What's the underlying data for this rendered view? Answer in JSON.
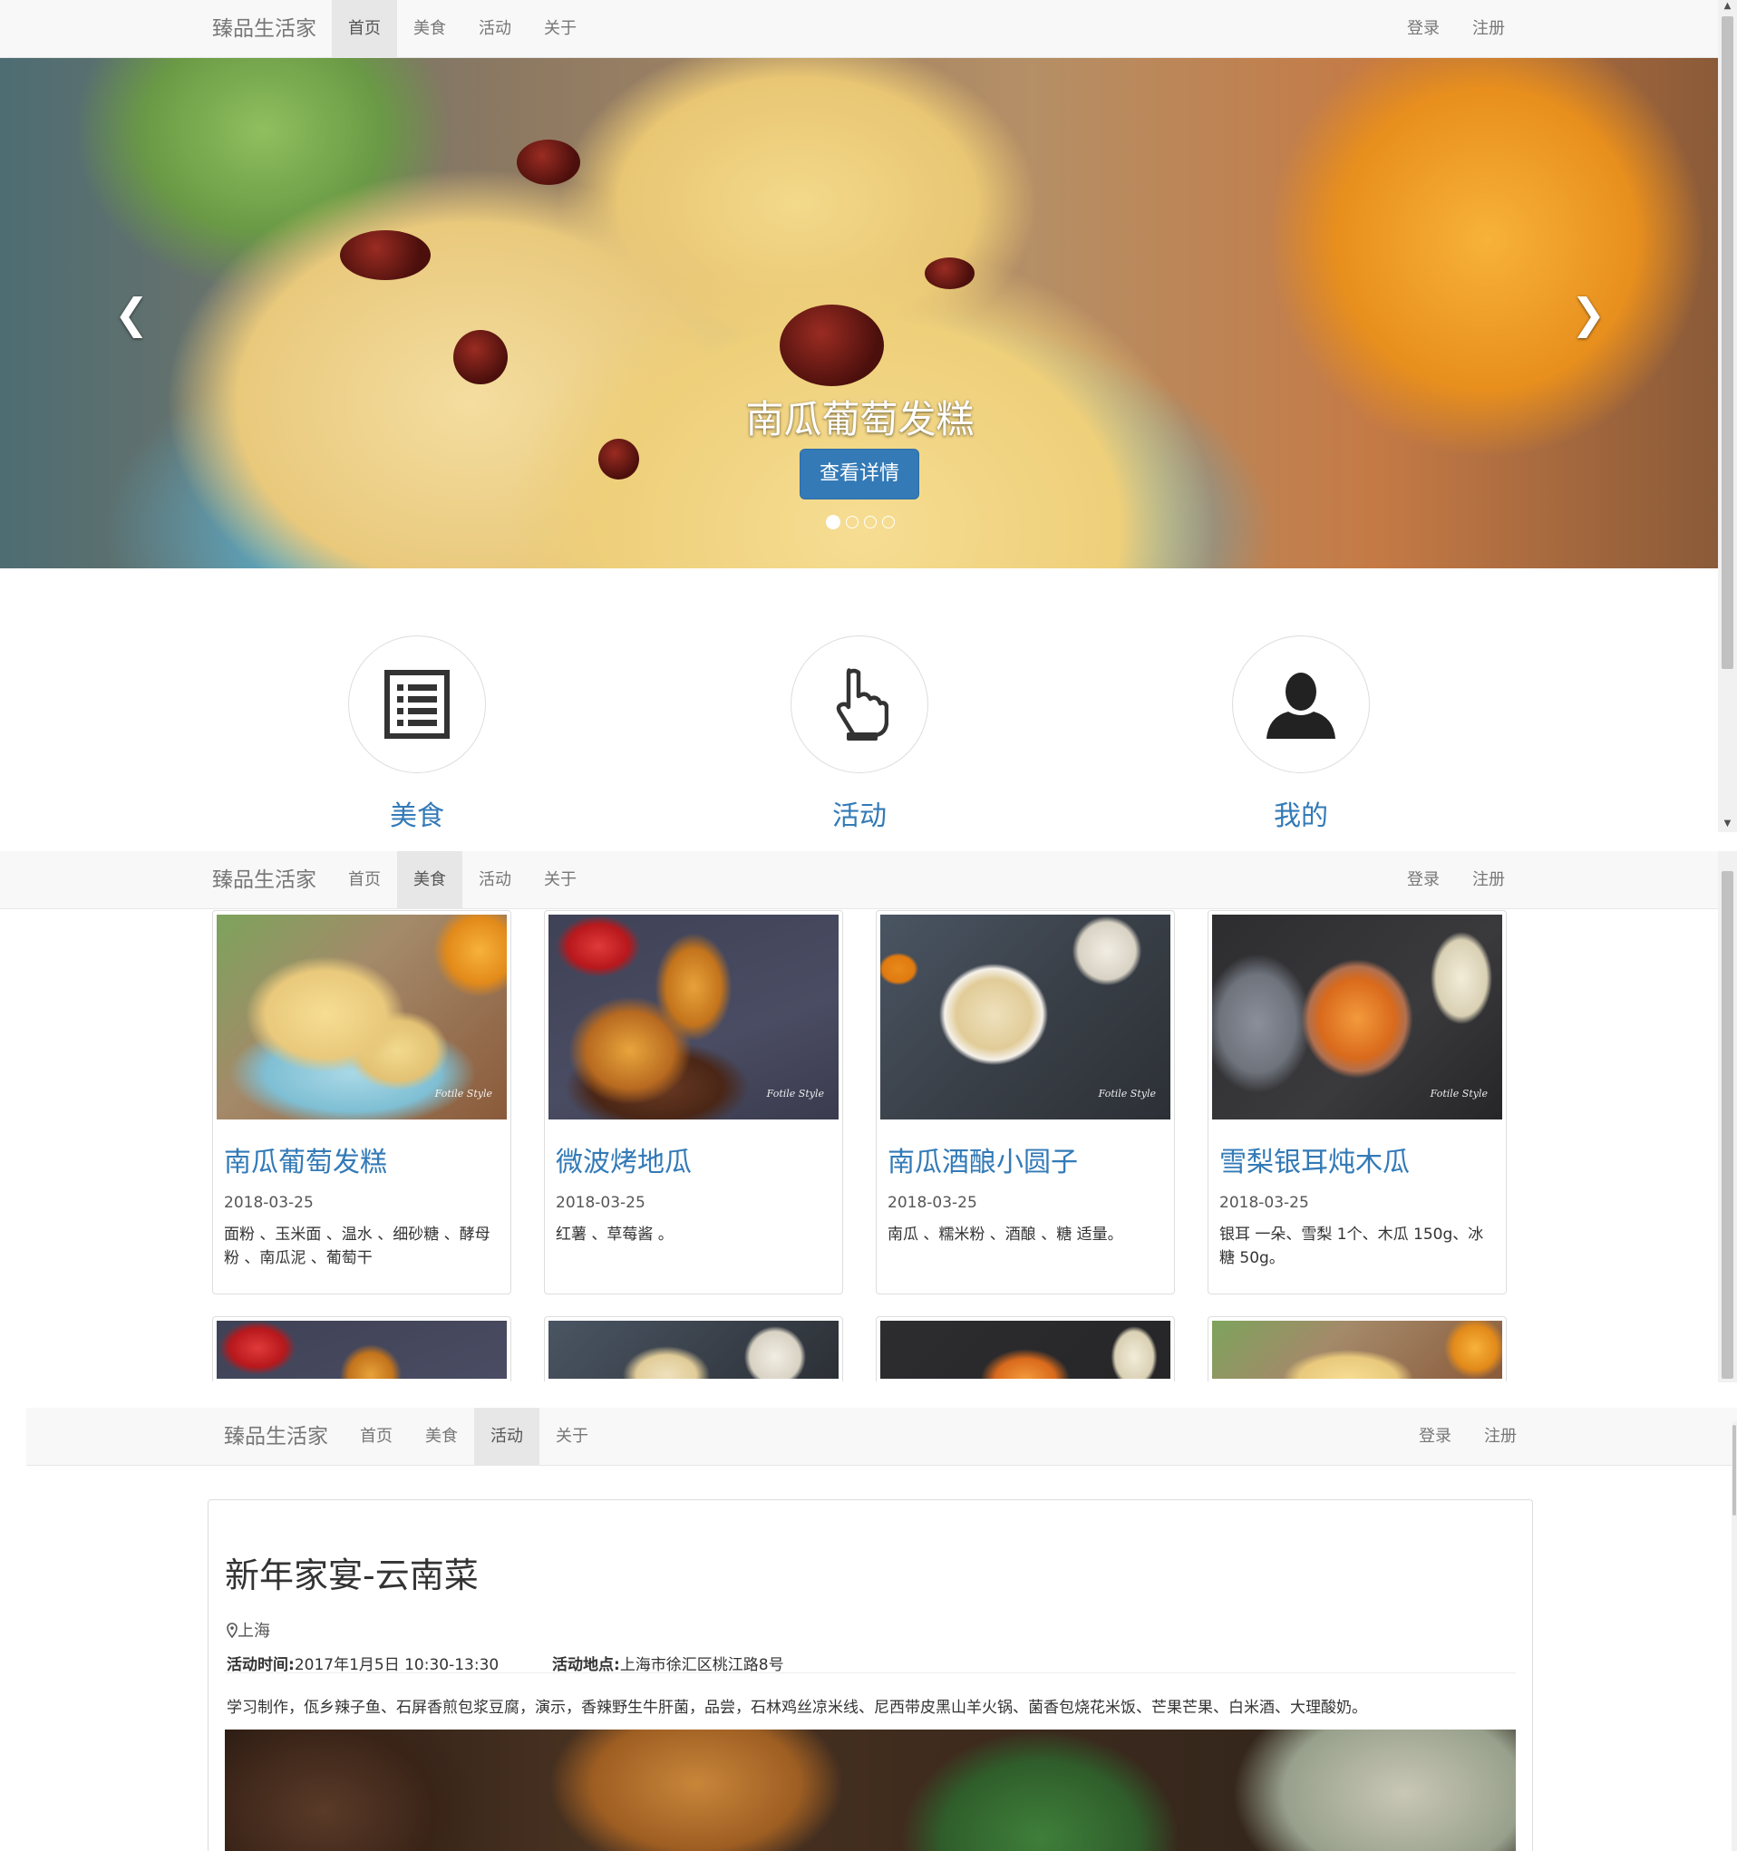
{
  "brand": "臻品生活家",
  "nav": {
    "home": "首页",
    "food": "美食",
    "activity": "活动",
    "about": "关于",
    "login": "登录",
    "register": "注册"
  },
  "hero": {
    "caption": "南瓜葡萄发糕",
    "button": "查看详情",
    "slide_count": 4,
    "active_slide": 1
  },
  "features": [
    {
      "label": "美食",
      "icon": "list-icon"
    },
    {
      "label": "活动",
      "icon": "hand-pointer-icon"
    },
    {
      "label": "我的",
      "icon": "user-icon"
    }
  ],
  "recipes": [
    {
      "title": "南瓜葡萄发糕",
      "date": "2018-03-25",
      "ingredients": "面粉 、玉米面 、温水 、细砂糖 、酵母粉 、南瓜泥 、葡萄干"
    },
    {
      "title": "微波烤地瓜",
      "date": "2018-03-25",
      "ingredients": "红薯 、草莓酱 。"
    },
    {
      "title": "南瓜酒酿小圆子",
      "date": "2018-03-25",
      "ingredients": "南瓜 、糯米粉 、酒酿 、糖 适量。"
    },
    {
      "title": "雪梨银耳炖木瓜",
      "date": "2018-03-25",
      "ingredients": "银耳 一朵、雪梨 1个、木瓜 150g、冰糖 50g。"
    }
  ],
  "photo_signature": "Fotile Style",
  "activity": {
    "title": "新年家宴-云南菜",
    "location": "上海",
    "time_label": "活动时间:",
    "time_value": "2017年1月5日 10:30-13:30",
    "place_label": "活动地点:",
    "place_value": "上海市徐汇区桃江路8号",
    "description": "学习制作，佤乡辣子鱼、石屏香煎包浆豆腐，演示，香辣野生牛肝菌，品尝，石林鸡丝凉米线、尼西带皮黑山羊火锅、菌香包烧花米饭、芒果芒果、白米酒、大理酸奶。"
  },
  "colors": {
    "accent": "#337ab7",
    "navbar_bg": "#f8f8f8",
    "nav_active_bg": "#e7e7e7"
  }
}
